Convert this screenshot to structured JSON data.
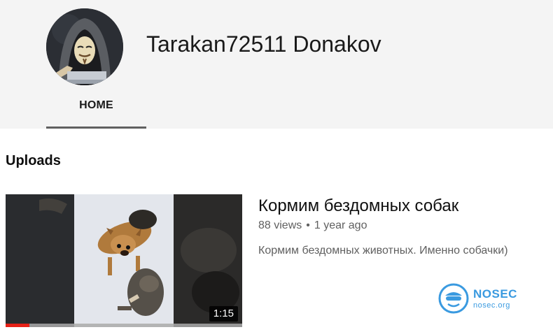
{
  "channel": {
    "name": "Tarakan72511 Donakov",
    "avatar_icon": "hooded-mask-avatar"
  },
  "tabs": [
    {
      "label": "HOME",
      "selected": true
    }
  ],
  "uploads": {
    "section_title": "Uploads",
    "videos": [
      {
        "title": "Кормим бездомных собак",
        "views": "88 views",
        "age": "1 year ago",
        "description": "Кормим бездомных животных. Именно собачки)",
        "duration": "1:15",
        "watched_fraction": 0.1
      }
    ]
  },
  "watermark": {
    "name": "NOSEC",
    "url": "nosec.org",
    "color": "#3a9ae0"
  },
  "colors": {
    "header_bg": "#f4f4f4",
    "tab_underline": "#606060",
    "progress": "#e62117",
    "meta_text": "#606060"
  }
}
